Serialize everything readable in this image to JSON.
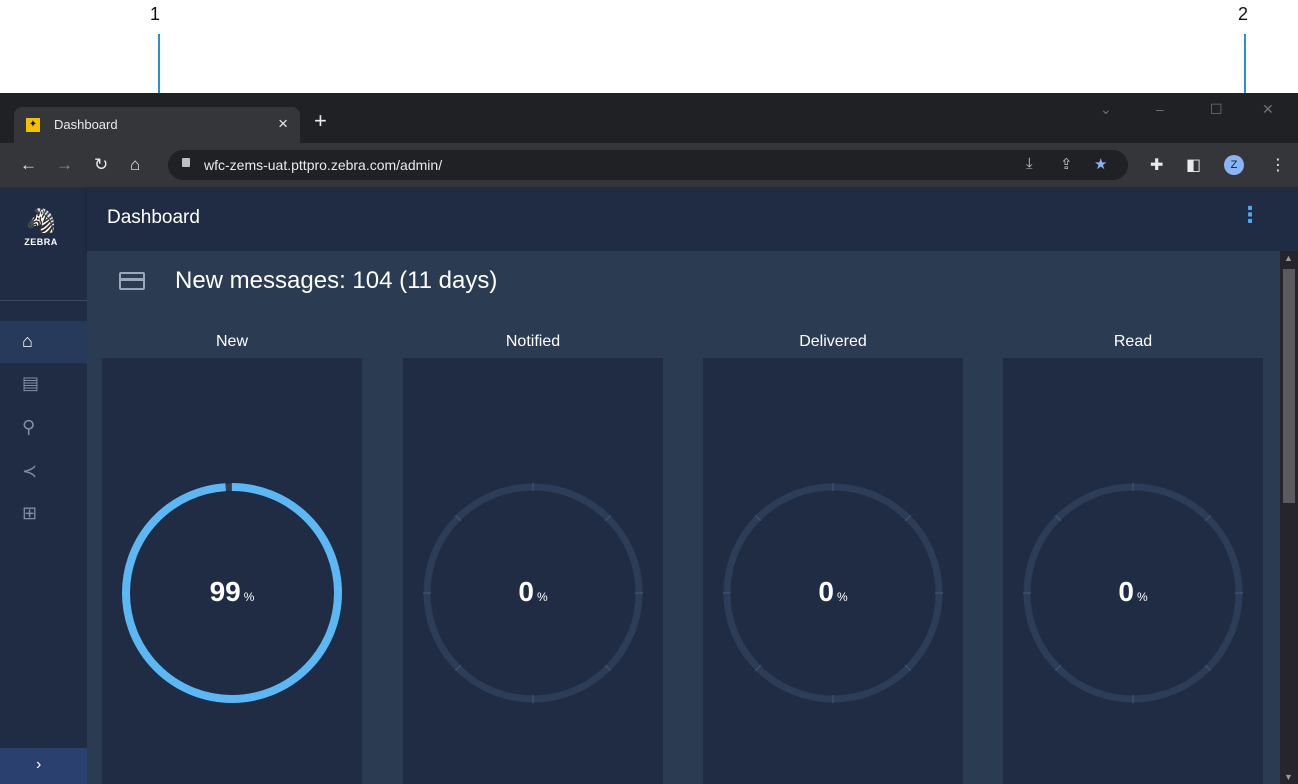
{
  "callouts": [
    "1",
    "2"
  ],
  "browser": {
    "tab_title": "Dashboard",
    "tab_close": "×",
    "new_tab": "+",
    "url": "wfc-zems-uat.pttpro.zebra.com/admin/",
    "avatar_initial": "Z"
  },
  "sidebar": {
    "logo_text": "ZEBRA",
    "items": [
      {
        "icon": "home-icon",
        "active": true
      },
      {
        "icon": "document-icon",
        "active": false
      },
      {
        "icon": "hierarchy-icon",
        "active": false
      },
      {
        "icon": "share-icon",
        "active": false
      },
      {
        "icon": "network-icon",
        "active": false
      }
    ],
    "expand_glyph": "›"
  },
  "header": {
    "title": "Dashboard"
  },
  "summary": {
    "text": "New messages: 104 (11 days)"
  },
  "stats": [
    {
      "label": "New",
      "value": "99",
      "unit": "%",
      "percent": 99
    },
    {
      "label": "Notified",
      "value": "0",
      "unit": "%",
      "percent": 0
    },
    {
      "label": "Delivered",
      "value": "0",
      "unit": "%",
      "percent": 0
    },
    {
      "label": "Read",
      "value": "0",
      "unit": "%",
      "percent": 0
    }
  ],
  "colors": {
    "gauge_fill": "#5bb8f5",
    "gauge_track": "#2d3d57",
    "accent": "#4fa8f0"
  }
}
